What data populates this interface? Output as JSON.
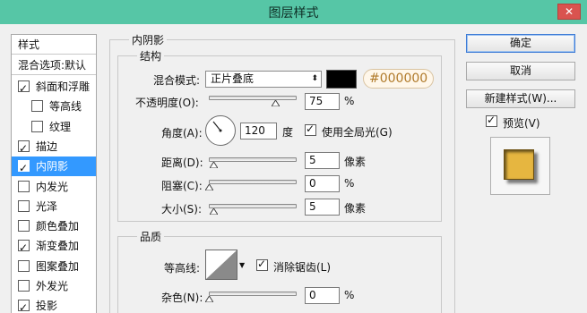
{
  "window": {
    "title": "图层样式",
    "close": "✕"
  },
  "left_panel": {
    "header": "样式",
    "blend_options": "混合选项:默认",
    "items": [
      {
        "label": "斜面和浮雕",
        "checked": true,
        "indent": false
      },
      {
        "label": "等高线",
        "checked": false,
        "indent": true
      },
      {
        "label": "纹理",
        "checked": false,
        "indent": true
      },
      {
        "label": "描边",
        "checked": true,
        "indent": false
      },
      {
        "label": "内阴影",
        "checked": true,
        "indent": false,
        "selected": true
      },
      {
        "label": "内发光",
        "checked": false,
        "indent": false
      },
      {
        "label": "光泽",
        "checked": false,
        "indent": false
      },
      {
        "label": "颜色叠加",
        "checked": false,
        "indent": false
      },
      {
        "label": "渐变叠加",
        "checked": true,
        "indent": false
      },
      {
        "label": "图案叠加",
        "checked": false,
        "indent": false
      },
      {
        "label": "外发光",
        "checked": false,
        "indent": false
      },
      {
        "label": "投影",
        "checked": true,
        "indent": false
      }
    ]
  },
  "inner_shadow": {
    "group_title": "内阴影",
    "structure": {
      "title": "结构",
      "blend_mode_label": "混合模式:",
      "blend_mode_value": "正片叠底",
      "color_hex": "#000000",
      "opacity_label": "不透明度(O):",
      "opacity_value": "75",
      "opacity_unit": "%",
      "opacity_level": 0.75,
      "angle_label": "角度(A):",
      "angle_value": "120",
      "angle_unit": "度",
      "global_light_label": "使用全局光(G)",
      "global_light_checked": true,
      "distance_label": "距离(D):",
      "distance_value": "5",
      "distance_unit": "像素",
      "choke_label": "阻塞(C):",
      "choke_value": "0",
      "choke_unit": "%",
      "size_label": "大小(S):",
      "size_value": "5",
      "size_unit": "像素"
    },
    "quality": {
      "title": "品质",
      "contour_label": "等高线:",
      "anti_alias_label": "消除锯齿(L)",
      "anti_alias_checked": true,
      "noise_label": "杂色(N):",
      "noise_value": "0",
      "noise_unit": "%"
    }
  },
  "buttons": {
    "ok": "确定",
    "cancel": "取消",
    "new_style": "新建样式(W)...",
    "preview_label": "预览(V)",
    "preview_checked": true
  },
  "colors": {
    "titlebar": "#56c6a6",
    "selection": "#3399ff",
    "hex_text": "#b07a2a",
    "preview_fill": "#e6b640"
  }
}
